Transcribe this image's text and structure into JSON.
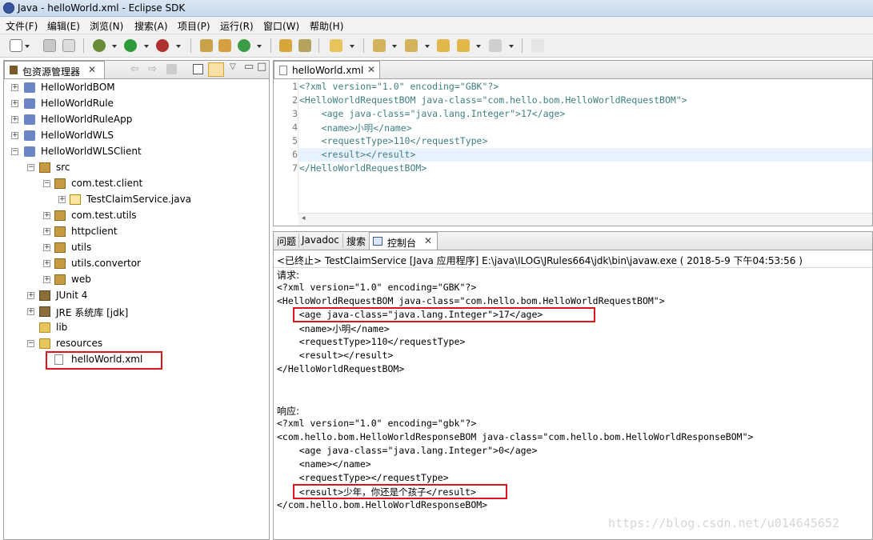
{
  "window": {
    "title": "Java  -  helloWorld.xml  -  Eclipse SDK"
  },
  "menu": [
    "文件(F)",
    "编辑(E)",
    "浏览(N)",
    "搜索(A)",
    "项目(P)",
    "运行(R)",
    "窗口(W)",
    "帮助(H)"
  ],
  "explorer": {
    "tab_label": "包资源管理器",
    "tree": [
      {
        "label": "HelloWorldBOM",
        "type": "project"
      },
      {
        "label": "HelloWorldRule",
        "type": "project"
      },
      {
        "label": "HelloWorldRuleApp",
        "type": "project"
      },
      {
        "label": "HelloWorldWLS",
        "type": "project"
      },
      {
        "label": "HelloWorldWLSClient",
        "type": "project"
      },
      {
        "label": "src",
        "type": "srcfolder"
      },
      {
        "label": "com.test.client",
        "type": "package"
      },
      {
        "label": "TestClaimService.java",
        "type": "java"
      },
      {
        "label": "com.test.utils",
        "type": "package"
      },
      {
        "label": "httpclient",
        "type": "package"
      },
      {
        "label": "utils",
        "type": "package"
      },
      {
        "label": "utils.convertor",
        "type": "package"
      },
      {
        "label": "web",
        "type": "package"
      },
      {
        "label": "JUnit 4",
        "type": "library"
      },
      {
        "label": "JRE 系统库 [jdk]",
        "type": "library"
      },
      {
        "label": "lib",
        "type": "folder"
      },
      {
        "label": "resources",
        "type": "folder"
      },
      {
        "label": "helloWorld.xml",
        "type": "file"
      }
    ]
  },
  "editor": {
    "tab_label": "helloWorld.xml",
    "lines": [
      "<?xml version=\"1.0\" encoding=\"GBK\"?>",
      "<HelloWorldRequestBOM java-class=\"com.hello.bom.HelloWorldRequestBOM\">",
      "    <age java-class=\"java.lang.Integer\">17</age>",
      "    <name>小明</name>",
      "    <requestType>110</requestType>",
      "    <result></result>",
      "</HelloWorldRequestBOM>"
    ],
    "line_numbers": [
      "1",
      "2",
      "3",
      "4",
      "5",
      "6",
      "7"
    ]
  },
  "console": {
    "tabs": [
      "问题",
      "Javadoc",
      "搜索",
      "控制台"
    ],
    "status": "<已终止> TestClaimService [Java 应用程序] E:\\java\\ILOG\\JRules664\\jdk\\bin\\javaw.exe ( 2018-5-9 下午04:53:56 )",
    "lines": [
      "请求:",
      "<?xml version=\"1.0\" encoding=\"GBK\"?>",
      "<HelloWorldRequestBOM java-class=\"com.hello.bom.HelloWorldRequestBOM\">",
      "    <age java-class=\"java.lang.Integer\">17</age>",
      "    <name>小明</name>",
      "    <requestType>110</requestType>",
      "    <result></result>",
      "</HelloWorldRequestBOM>",
      "",
      "",
      "响应:",
      "<?xml version=\"1.0\" encoding=\"gbk\"?>",
      "<com.hello.bom.HelloWorldResponseBOM java-class=\"com.hello.bom.HelloWorldResponseBOM\">",
      "    <age java-class=\"java.lang.Integer\">0</age>",
      "    <name></name>",
      "    <requestType></requestType>",
      "    <result>少年，你还是个孩子</result>",
      "</com.hello.bom.HelloWorldResponseBOM>"
    ]
  },
  "watermark": "https://blog.csdn.net/u014645652"
}
